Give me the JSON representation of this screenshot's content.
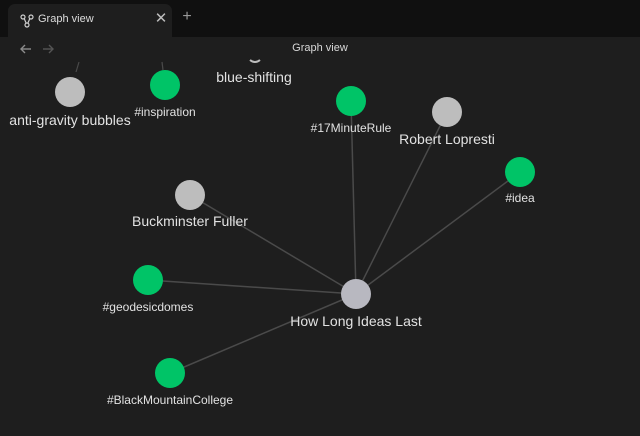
{
  "tab": {
    "title": "Graph view",
    "icon": "graph-icon"
  },
  "header": {
    "title": "Graph view"
  },
  "colors": {
    "background": "#1e1e1e",
    "tab_bar": "#101010",
    "tag_node": "#00c467",
    "note_node": "#bdbdbd",
    "active_node": "#b8b8c0",
    "edge": "#4a4a4a"
  },
  "graph": {
    "nodes": [
      {
        "id": "anti-gravity",
        "label": "anti-gravity bubbles",
        "kind": "note"
      },
      {
        "id": "inspiration",
        "label": "#inspiration",
        "kind": "tag"
      },
      {
        "id": "blue-shifting",
        "label": "blue-shifting",
        "kind": "note"
      },
      {
        "id": "17minute",
        "label": "#17MinuteRule",
        "kind": "tag"
      },
      {
        "id": "lopresti",
        "label": "Robert Lopresti",
        "kind": "note"
      },
      {
        "id": "idea",
        "label": "#idea",
        "kind": "tag"
      },
      {
        "id": "fuller",
        "label": "Buckminster Fuller",
        "kind": "note"
      },
      {
        "id": "geodesic",
        "label": "#geodesicdomes",
        "kind": "tag"
      },
      {
        "id": "how-long",
        "label": "How Long Ideas Last",
        "kind": "active"
      },
      {
        "id": "bmc",
        "label": "#BlackMountainCollege",
        "kind": "tag"
      }
    ],
    "edges": [
      [
        "how-long",
        "17minute"
      ],
      [
        "how-long",
        "lopresti"
      ],
      [
        "how-long",
        "idea"
      ],
      [
        "how-long",
        "fuller"
      ],
      [
        "how-long",
        "geodesic"
      ],
      [
        "how-long",
        "bmc"
      ]
    ]
  }
}
